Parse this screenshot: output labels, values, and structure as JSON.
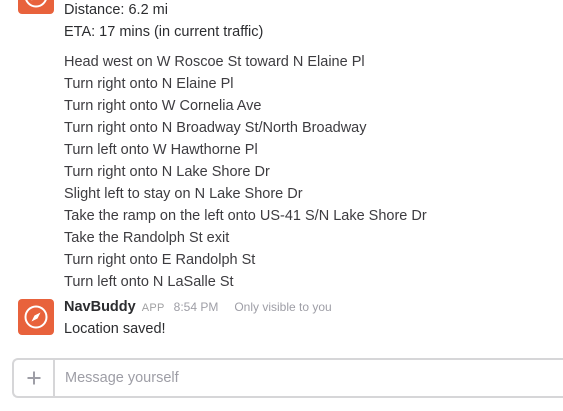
{
  "route_summary": {
    "distance": "Distance: 6.2 mi",
    "eta": "ETA: 17 mins (in current traffic)"
  },
  "directions": [
    "Head west on W Roscoe St toward N Elaine Pl",
    "Turn right onto N Elaine Pl",
    "Turn right onto W Cornelia Ave",
    "Turn right onto N Broadway St/North Broadway",
    "Turn left onto W Hawthorne Pl",
    "Turn right onto N Lake Shore Dr",
    "Slight left to stay on N Lake Shore Dr",
    "Take the ramp on the left onto US-41 S/N Lake Shore Dr",
    "Take the Randolph St exit",
    "Turn right onto E Randolph St",
    "Turn left onto N LaSalle St"
  ],
  "message": {
    "sender": "NavBuddy",
    "badge": "APP",
    "time": "8:54 PM",
    "visibility": "Only visible to you",
    "text": "Location saved!"
  },
  "composer": {
    "placeholder": "Message yourself",
    "add_icon": "plus-icon"
  },
  "colors": {
    "avatar_bg": "#e8623c",
    "text": "#2c2d30",
    "muted": "#9e9ea6",
    "border": "#d6d6d8"
  },
  "icons": {
    "avatar": "compass-icon"
  }
}
